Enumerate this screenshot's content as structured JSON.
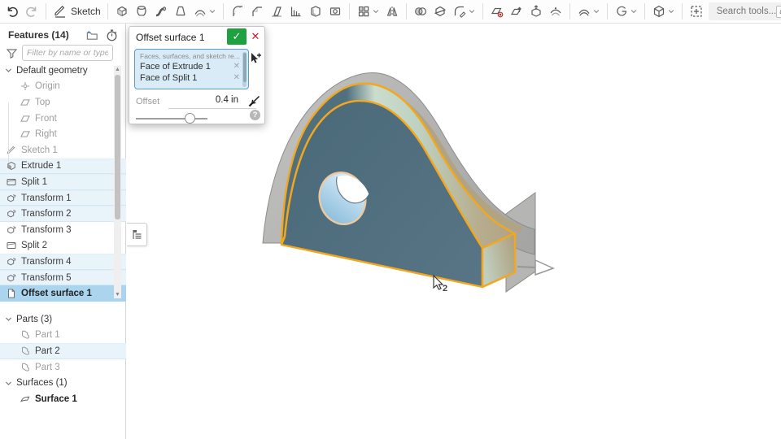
{
  "toolbar": {
    "groups": [
      {
        "items": [
          {
            "name": "undo"
          },
          {
            "name": "redo"
          }
        ]
      },
      {
        "items": [
          {
            "name": "sketch",
            "label": "Sketch"
          }
        ]
      },
      {
        "items": [
          {
            "name": "extrude"
          },
          {
            "name": "revolve"
          },
          {
            "name": "sweep"
          },
          {
            "name": "loft"
          },
          {
            "name": "thicken",
            "dropdown": true
          }
        ]
      },
      {
        "items": [
          {
            "name": "fillet"
          },
          {
            "name": "chamfer"
          },
          {
            "name": "draft"
          },
          {
            "name": "rib"
          },
          {
            "name": "shell"
          },
          {
            "name": "hole"
          }
        ]
      },
      {
        "items": [
          {
            "name": "linear-pattern",
            "dropdown": true
          },
          {
            "name": "mirror"
          }
        ]
      },
      {
        "items": [
          {
            "name": "boolean"
          },
          {
            "name": "split"
          },
          {
            "name": "modify-fillet",
            "dropdown": true
          }
        ]
      },
      {
        "items": [
          {
            "name": "delete-face"
          },
          {
            "name": "replace-face"
          },
          {
            "name": "export-part"
          },
          {
            "name": "offset-surface"
          }
        ]
      },
      {
        "items": [
          {
            "name": "thicken-surface",
            "dropdown": true
          }
        ]
      },
      {
        "items": [
          {
            "name": "enclose",
            "dropdown": true
          }
        ]
      },
      {
        "items": [
          {
            "name": "named-views",
            "dropdown": true
          }
        ]
      },
      {
        "items": [
          {
            "name": "select-region"
          }
        ]
      }
    ],
    "search": {
      "placeholder": "Search tools...",
      "shortcut": "alt"
    }
  },
  "features_panel": {
    "title": "Features (14)",
    "filter_placeholder": "Filter by name or type",
    "rows": [
      {
        "label": "Default geometry",
        "kind": "group"
      },
      {
        "label": "Origin",
        "icon": "origin",
        "indent": 1,
        "text": "gray"
      },
      {
        "label": "Top",
        "icon": "plane",
        "indent": 1,
        "text": "gray"
      },
      {
        "label": "Front",
        "icon": "plane",
        "indent": 1,
        "text": "gray"
      },
      {
        "label": "Right",
        "icon": "plane",
        "indent": 1,
        "text": "gray"
      },
      {
        "label": "Sketch 1",
        "icon": "sketch-s",
        "text": "gray"
      },
      {
        "label": "Extrude 1",
        "icon": "extrude-s",
        "bg": "hl"
      },
      {
        "label": "Split 1",
        "icon": "split-s",
        "bg": "hl"
      },
      {
        "label": "Transform 1",
        "icon": "transform-s",
        "bg": "hl"
      },
      {
        "label": "Transform 2",
        "icon": "transform-s",
        "bg": "hl"
      },
      {
        "label": "Transform 3",
        "icon": "transform-s"
      },
      {
        "label": "Split 2",
        "icon": "split-s"
      },
      {
        "label": "Transform 4",
        "icon": "transform-s",
        "bg": "hl"
      },
      {
        "label": "Transform 5",
        "icon": "transform-s",
        "bg": "hl"
      },
      {
        "label": "Offset surface 1",
        "icon": "offsetsurf-s",
        "bg": "sel",
        "text": "bold"
      }
    ],
    "parts_rows": [
      {
        "label": "Parts (3)",
        "kind": "group"
      },
      {
        "label": "Part 1",
        "icon": "part",
        "indent": 1,
        "text": "gray"
      },
      {
        "label": "Part 2",
        "icon": "part",
        "indent": 1,
        "bg": "hl"
      },
      {
        "label": "Part 3",
        "icon": "part",
        "indent": 1,
        "text": "gray"
      },
      {
        "label": "Surfaces (1)",
        "kind": "group"
      },
      {
        "label": "Surface 1",
        "icon": "surface",
        "indent": 1,
        "text": "bold"
      }
    ]
  },
  "dialog": {
    "title": "Offset surface 1",
    "confirm_glyph": "✓",
    "cancel_glyph": "✕",
    "selection_list": {
      "header": "Faces, surfaces, and sketch re...",
      "items": [
        "Face of Extrude 1",
        "Face of Split 1"
      ],
      "remove_glyph": "✕"
    },
    "offset": {
      "label": "Offset",
      "value": "0.4 in"
    },
    "slider_percent": 73,
    "help_glyph": "?"
  },
  "viewport": {
    "cursor_badge": "2"
  },
  "colors": {
    "selection_highlight": "#e9f3fa",
    "selection_active": "#abd5ef",
    "edge_highlight_orange": "#f2a71e",
    "confirm_green": "#1ea13f",
    "cancel_red": "#c8202c",
    "part_front_face": "#50707f",
    "part_top_face_mint": "#bccfc0",
    "offset_sheet_gray": "#b4b4b2",
    "hole_blue": "#9dc8e2",
    "list_box_blue": "#d9ebf7"
  }
}
